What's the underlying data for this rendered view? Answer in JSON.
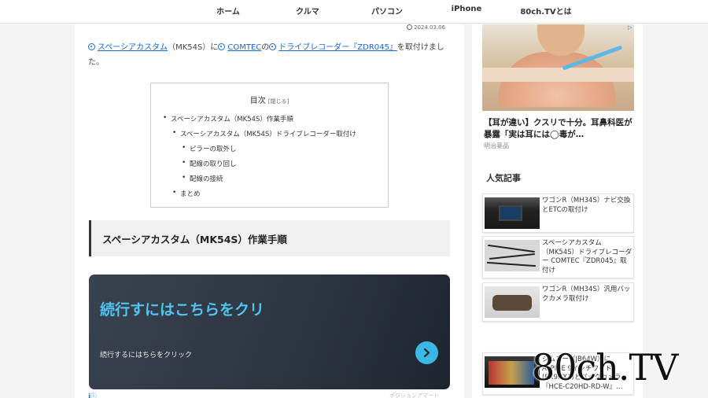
{
  "nav": {
    "items": [
      {
        "label": "ホーム",
        "icon": "home"
      },
      {
        "label": "クルマ",
        "icon": "car"
      },
      {
        "label": "パソコン",
        "icon": "pc"
      },
      {
        "label": "iPhone",
        "icon": "phone"
      },
      {
        "label": "80ch.TVとは",
        "icon": "info"
      }
    ]
  },
  "article": {
    "date": "2024.03.06",
    "intro": {
      "link1": "スペーシアカスタム",
      "text1": "（MK54S）に",
      "link2": "COMTEC",
      "text2": "の",
      "link3": "ドライブレコーダー『ZDR045』",
      "text3": "を取付けました。"
    },
    "toc": {
      "title": "目次",
      "toggle": "[閉じる]",
      "items": [
        "スペーシアカスタム（MK54S）作業手順",
        "スペーシアカスタム（MK54S）ドライブレコーダー取付け",
        "ピラーの取外し",
        "配線の取り回し",
        "配線の接続",
        "まとめ"
      ]
    },
    "heading": "スペーシアカスタム（MK54S）作業手順",
    "promo": {
      "title": "続行すにはこちらをクリ",
      "subtitle": "続行するにはちらをクリック",
      "accent": "#4ec6f0"
    },
    "footer_left": "ℹⓘ",
    "footer_right": "ポジションアマート"
  },
  "sidebar": {
    "ad": {
      "marker": "▷",
      "headline": "【耳が違い】クスリで十分。耳鼻科医が暴露「実は耳には◯毒が…",
      "sponsor": "明治薬品"
    },
    "popular_title": "人気記事",
    "popular": [
      {
        "title": "ワゴンR（MH34S）ナビ交換とETCの取付け",
        "thumb": "car-navigation-thumbnail"
      },
      {
        "title": "スペーシアカスタム（MK54S）ドライブレコーダー COMTEC『ZDR045』取付け",
        "thumb": "wiring-thumbnail"
      },
      {
        "title": "ワゴンR（MH34S）汎用バックカメラ取付け",
        "thumb": "back-camera-thumbnail"
      },
      {
        "title": "ジムニー（JB64W）にALPINE 9インチワイド(EX9NX2)とバックカメラ『HCE-C20HD-RD-W』…",
        "thumb": "dashboard-thumbnail"
      }
    ]
  },
  "watermark": "80ch.TV"
}
